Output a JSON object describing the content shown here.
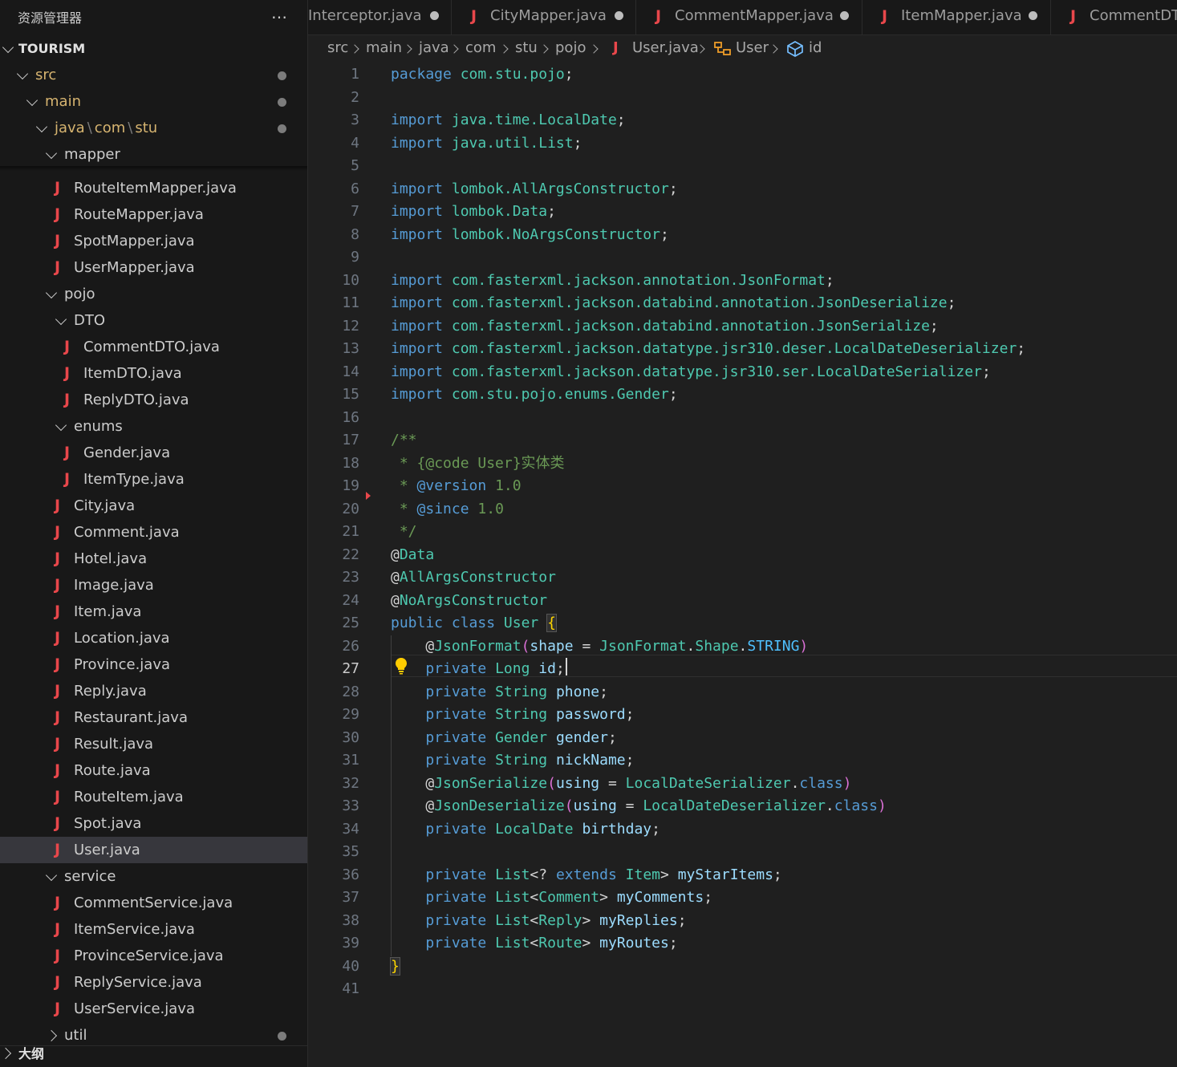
{
  "explorer": {
    "title": "资源管理器",
    "more_icon": "…",
    "root": "TOURISM",
    "src": "src",
    "main": "main",
    "java_path": [
      "java",
      "com",
      "stu"
    ],
    "mapper": "mapper",
    "mapper_files": [
      "RouteItemMapper.java",
      "RouteMapper.java",
      "SpotMapper.java",
      "UserMapper.java"
    ],
    "pojo": "pojo",
    "dto": "DTO",
    "dto_files": [
      "CommentDTO.java",
      "ItemDTO.java",
      "ReplyDTO.java"
    ],
    "enums": "enums",
    "enum_files": [
      "Gender.java",
      "ItemType.java"
    ],
    "pojo_files": [
      "City.java",
      "Comment.java",
      "Hotel.java",
      "Image.java",
      "Item.java",
      "Location.java",
      "Province.java",
      "Reply.java",
      "Restaurant.java",
      "Result.java",
      "Route.java",
      "RouteItem.java",
      "Spot.java",
      "User.java"
    ],
    "service": "service",
    "service_files": [
      "CommentService.java",
      "ItemService.java",
      "ProvinceService.java",
      "ReplyService.java",
      "UserService.java"
    ],
    "util": "util",
    "outline": "大纲",
    "java_icon_glyph": "J"
  },
  "tabs": [
    "Interceptor.java",
    "CityMapper.java",
    "CommentMapper.java",
    "ItemMapper.java",
    "CommentDTO.java"
  ],
  "breadcrumb": {
    "src": "src",
    "main": "main",
    "java": "java",
    "com": "com",
    "stu": "stu",
    "pojo": "pojo",
    "file": "User.java",
    "class": "User",
    "field": "id"
  },
  "editor": {
    "line_numbers": [
      "1",
      "2",
      "3",
      "4",
      "5",
      "6",
      "7",
      "8",
      "9",
      "10",
      "11",
      "12",
      "13",
      "14",
      "15",
      "16",
      "17",
      "18",
      "19",
      "20",
      "21",
      "22",
      "23",
      "24",
      "25",
      "26",
      "27",
      "28",
      "29",
      "30",
      "31",
      "32",
      "33",
      "34",
      "35",
      "36",
      "37",
      "38",
      "39",
      "40",
      "41"
    ],
    "current_line": "27",
    "code": {
      "package_kw": "package",
      "package_name": "com.stu.pojo",
      "import_kw": "import",
      "imports": [
        "java.time.LocalDate",
        "java.util.List",
        "lombok.AllArgsConstructor",
        "lombok.Data",
        "lombok.NoArgsConstructor",
        "com.fasterxml.jackson.annotation.JsonFormat",
        "com.fasterxml.jackson.databind.annotation.JsonDeserialize",
        "com.fasterxml.jackson.databind.annotation.JsonSerialize",
        "com.fasterxml.jackson.datatype.jsr310.deser.LocalDateDeserializer",
        "com.fasterxml.jackson.datatype.jsr310.ser.LocalDateSerializer",
        "com.stu.pojo.enums.Gender"
      ],
      "doc_open": "/**",
      "doc_code": "{@code User}实体类",
      "doc_version_tag": "@version",
      "doc_version": "1.0",
      "doc_since_tag": "@since",
      "doc_since": "1.0",
      "doc_close": "*/",
      "ann_data": "Data",
      "ann_all": "AllArgsConstructor",
      "ann_no": "NoArgsConstructor",
      "public_kw": "public",
      "class_kw": "class",
      "class_name": "User",
      "json_format": "JsonFormat",
      "shape": "shape",
      "shape_type": "JsonFormat",
      "shape_enum": "Shape",
      "shape_val": "STRING",
      "private_kw": "private",
      "fields": [
        {
          "type": "Long",
          "name": "id"
        },
        {
          "type": "String",
          "name": "phone"
        },
        {
          "type": "String",
          "name": "password"
        },
        {
          "type": "Gender",
          "name": "gender"
        },
        {
          "type": "String",
          "name": "nickName"
        }
      ],
      "json_serialize": "JsonSerialize",
      "using": "using",
      "serializer": "LocalDateSerializer",
      "json_deserialize": "JsonDeserialize",
      "deserializer": "LocalDateDeserializer",
      "class_kw2": "class",
      "birthday_type": "LocalDate",
      "birthday": "birthday",
      "list": "List",
      "extends_kw": "extends",
      "list_fields": [
        {
          "generic": "Item",
          "name": "myStarItems"
        },
        {
          "generic": "Comment",
          "name": "myComments"
        },
        {
          "generic": "Reply",
          "name": "myReplies"
        },
        {
          "generic": "Route",
          "name": "myRoutes"
        }
      ]
    }
  },
  "colors": {
    "keyword": "#569cd6",
    "type": "#4ec9b0",
    "variable": "#9cdcfe",
    "comment": "#6a9955",
    "java_icon": "#e8474b",
    "modified": "#d6b470",
    "selection": "#37373d"
  }
}
